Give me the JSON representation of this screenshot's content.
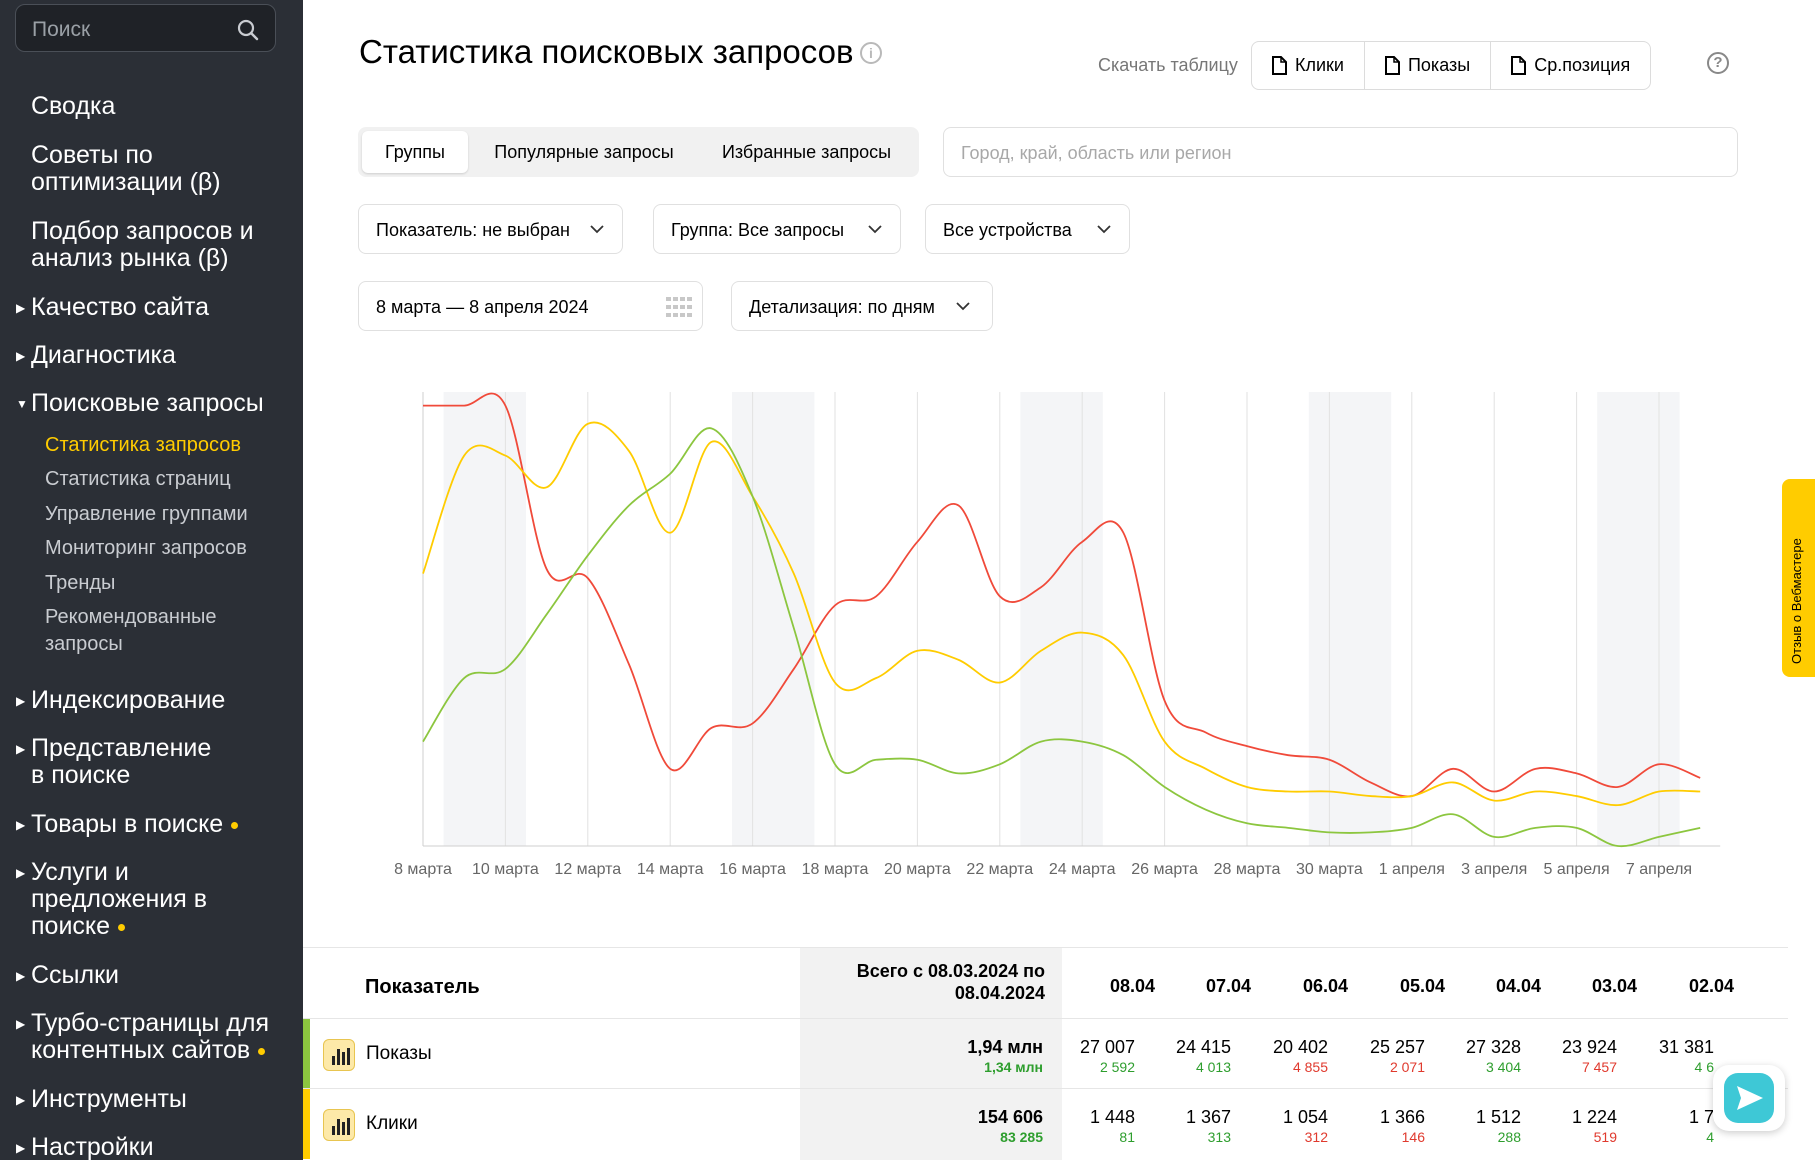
{
  "sidebar": {
    "search_placeholder": "Поиск",
    "items": [
      {
        "label": "Сводка"
      },
      {
        "label_lines": [
          "Советы по",
          "оптимизации (β)"
        ]
      },
      {
        "label_lines": [
          "Подбор запросов и",
          "анализ рынка (β)"
        ]
      },
      {
        "label": "Качество сайта"
      },
      {
        "label": "Диагностика"
      },
      {
        "label": "Поисковые запросы"
      },
      {
        "label": "Индексирование"
      },
      {
        "label_lines": [
          "Представление",
          "в поиске"
        ]
      },
      {
        "label": "Товары в поиске"
      },
      {
        "label_lines": [
          "Услуги и",
          "предложения в",
          "поиске"
        ]
      },
      {
        "label": "Ссылки"
      },
      {
        "label_lines": [
          "Турбо-страницы для",
          "контентных сайтов"
        ]
      },
      {
        "label": "Инструменты"
      },
      {
        "label": "Настройки"
      }
    ],
    "subitems": [
      {
        "label": "Статистика запросов",
        "active": true
      },
      {
        "label": "Статистика страниц"
      },
      {
        "label": "Управление группами"
      },
      {
        "label": "Мониторинг запросов"
      },
      {
        "label": "Тренды"
      },
      {
        "label_lines": [
          "Рекомендованные",
          "запросы"
        ]
      }
    ]
  },
  "header": {
    "title": "Статистика поисковых запросов",
    "download_label": "Скачать таблицу",
    "download_buttons": [
      "Клики",
      "Показы",
      "Ср.позиция"
    ]
  },
  "tabs": [
    "Группы",
    "Популярные запросы",
    "Избранные запросы"
  ],
  "region_placeholder": "Город, край, область или регион",
  "filters": {
    "indicator": "Показатель: не выбран",
    "group": "Группа: Все запросы",
    "devices": "Все устройства",
    "date_range": "8 марта — 8 апреля 2024",
    "detail": "Детализация: по дням"
  },
  "chart_data": {
    "type": "line",
    "x_labels": [
      "8 марта",
      "10 марта",
      "12 марта",
      "14 марта",
      "16 марта",
      "18 марта",
      "20 марта",
      "22 марта",
      "24 марта",
      "26 марта",
      "28 марта",
      "30 марта",
      "1 апреля",
      "3 апреля",
      "5 апреля",
      "7 апреля"
    ],
    "x": [
      "08.03",
      "09.03",
      "10.03",
      "11.03",
      "12.03",
      "13.03",
      "14.03",
      "15.03",
      "16.03",
      "17.03",
      "18.03",
      "19.03",
      "20.03",
      "21.03",
      "22.03",
      "23.03",
      "24.03",
      "25.03",
      "26.03",
      "27.03",
      "28.03",
      "29.03",
      "30.03",
      "31.03",
      "01.04",
      "02.04",
      "03.04",
      "04.04",
      "05.04",
      "06.04",
      "07.04",
      "08.04"
    ],
    "weekends": [
      [
        "09.03",
        "10.03"
      ],
      [
        "16.03",
        "17.03"
      ],
      [
        "23.03",
        "24.03"
      ],
      [
        "30.03",
        "31.03"
      ],
      [
        "06.04",
        "07.04"
      ]
    ],
    "series": [
      {
        "color": "#f04a3a",
        "values": [
          0.97,
          0.97,
          0.97,
          0.61,
          0.59,
          0.4,
          0.17,
          0.26,
          0.27,
          0.39,
          0.53,
          0.55,
          0.67,
          0.75,
          0.55,
          0.57,
          0.67,
          0.69,
          0.32,
          0.25,
          0.22,
          0.2,
          0.19,
          0.14,
          0.11,
          0.17,
          0.12,
          0.17,
          0.16,
          0.13,
          0.18,
          0.15
        ]
      },
      {
        "color": "#ffcc00",
        "values": [
          0.6,
          0.86,
          0.86,
          0.79,
          0.93,
          0.87,
          0.69,
          0.89,
          0.77,
          0.6,
          0.36,
          0.37,
          0.43,
          0.41,
          0.36,
          0.43,
          0.47,
          0.42,
          0.23,
          0.17,
          0.13,
          0.12,
          0.12,
          0.11,
          0.11,
          0.14,
          0.1,
          0.12,
          0.11,
          0.09,
          0.12,
          0.12
        ]
      },
      {
        "color": "#8cc63f",
        "values": [
          0.23,
          0.37,
          0.39,
          0.51,
          0.64,
          0.75,
          0.82,
          0.92,
          0.77,
          0.48,
          0.18,
          0.19,
          0.19,
          0.16,
          0.18,
          0.23,
          0.23,
          0.2,
          0.13,
          0.08,
          0.05,
          0.04,
          0.03,
          0.03,
          0.04,
          0.07,
          0.02,
          0.04,
          0.04,
          0.0,
          0.02,
          0.04
        ]
      }
    ]
  },
  "table": {
    "header_indicator": "Показатель",
    "header_total_lines": [
      "Всего с 08.03.2024 по",
      "08.04.2024"
    ],
    "dates": [
      "08.04",
      "07.04",
      "06.04",
      "05.04",
      "04.04",
      "03.04",
      "02.04"
    ],
    "rows": [
      {
        "label": "Показы",
        "bar_color": "#8cc63f",
        "total": "1,94 млн",
        "total_sub": "1,34 млн",
        "total_sub_color": "green",
        "values": [
          "27 007",
          "24 415",
          "20 402",
          "25 257",
          "27 328",
          "23 924",
          "31 381"
        ],
        "subs": [
          "2 592",
          "4 013",
          "4 855",
          "2 071",
          "3 404",
          "7 457",
          "4 6"
        ],
        "sub_colors": [
          "green",
          "green",
          "red",
          "red",
          "green",
          "red",
          "green"
        ]
      },
      {
        "label": "Клики",
        "bar_color": "#ffcc00",
        "total": "154 606",
        "total_sub": "83 285",
        "total_sub_color": "green",
        "values": [
          "1 448",
          "1 367",
          "1 054",
          "1 366",
          "1 512",
          "1 224",
          "1 7"
        ],
        "subs": [
          "81",
          "313",
          "312",
          "146",
          "288",
          "519",
          "4"
        ],
        "sub_colors": [
          "green",
          "green",
          "red",
          "red",
          "green",
          "red",
          "green"
        ]
      }
    ]
  },
  "feedback_label": "Отзыв о Вебмастере"
}
